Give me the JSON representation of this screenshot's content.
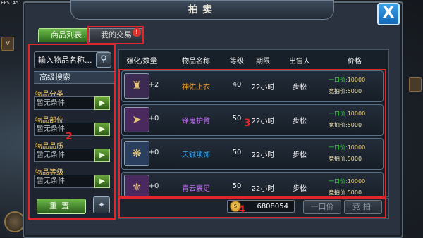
{
  "fps": "FPS:45",
  "window": {
    "title": "拍卖",
    "close_label": "X"
  },
  "tabs": [
    {
      "label": "商品列表",
      "active": true
    },
    {
      "label": "我的交易",
      "active": false,
      "badge": "!"
    }
  ],
  "search": {
    "placeholder": "输入物品名称..."
  },
  "advanced": {
    "header": "高级搜索",
    "filters": [
      {
        "label": "物品分类",
        "value": "暂无条件"
      },
      {
        "label": "物品部位",
        "value": "暂无条件"
      },
      {
        "label": "物品品质",
        "value": "暂无条件"
      },
      {
        "label": "物品等级",
        "value": "暂无条件"
      }
    ],
    "reset_label": "重置"
  },
  "table": {
    "headers": [
      "强化/数量",
      "物品名称",
      "等级",
      "期限",
      "出售人",
      "价格"
    ],
    "rows": [
      {
        "strength": "+2",
        "name": "神佑上衣",
        "name_color": "#f0a030",
        "level": "40",
        "limit": "22小时",
        "seller": "步松",
        "buyout_label": "一口价:",
        "buyout": "10000",
        "bid_label": "竞拍价:",
        "bid": "5000",
        "icon": "armor-icon",
        "icon_bg": "#3b2a52"
      },
      {
        "strength": "+0",
        "name": "锋鬼护臂",
        "name_color": "#c070f0",
        "level": "50",
        "limit": "22小时",
        "seller": "步松",
        "buyout_label": "一口价:",
        "buyout": "10000",
        "bid_label": "竞拍价:",
        "bid": "5000",
        "icon": "bracer-icon",
        "icon_bg": "#4a2a5e"
      },
      {
        "strength": "+0",
        "name": "天铖项饰",
        "name_color": "#38a8f0",
        "level": "50",
        "limit": "22小时",
        "seller": "步松",
        "buyout_label": "一口价:",
        "buyout": "10000",
        "bid_label": "竞拍价:",
        "bid": "5000",
        "icon": "necklace-icon",
        "icon_bg": "#2a3e5e"
      },
      {
        "strength": "+0",
        "name": "青云裹足",
        "name_color": "#c070f0",
        "level": "50",
        "limit": "22小时",
        "seller": "步松",
        "buyout_label": "一口价:",
        "buyout": "10000",
        "bid_label": "竞拍价:",
        "bid": "5000",
        "icon": "boots-icon",
        "icon_bg": "#4a2a5e"
      }
    ]
  },
  "bottom": {
    "money": "6808054",
    "buyout_btn": "一口价",
    "bid_btn": "竞拍"
  },
  "annotations": [
    "1",
    "2",
    "3",
    "4"
  ],
  "colors": {
    "annotation": "#e0262a",
    "tab_active": "#4f9a32",
    "close": "#1f7fd0"
  }
}
